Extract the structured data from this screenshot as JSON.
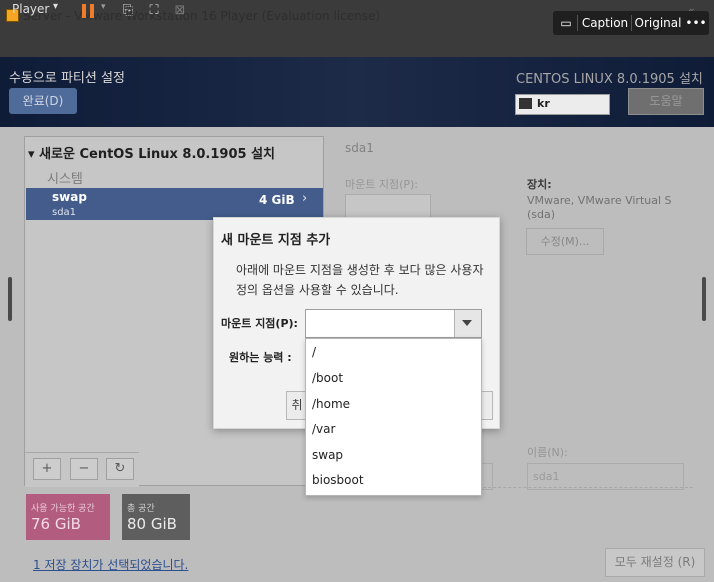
{
  "vmware": {
    "title": "Server - VMware Workstation 16 Player (Evaluation license)",
    "player_menu": "Player",
    "caption_bar": {
      "caption": "Caption",
      "original": "Original",
      "more": "•••"
    }
  },
  "installer": {
    "header_title": "수동으로 파티션 설정",
    "done_button": "완료(D)",
    "product_title": "CENTOS LINUX 8.0.1905 설치",
    "keyboard_layout": "kr",
    "help_button": "도움말"
  },
  "left_pane": {
    "install_title": "새로운 CentOS Linux 8.0.1905 설치",
    "section": "시스템",
    "selected_item": {
      "name": "swap",
      "device": "sda1",
      "size": "4 GiB"
    },
    "buttons": {
      "add": "+",
      "remove": "−",
      "refresh": "↻"
    },
    "available_space": {
      "label": "사용 가능한 공간",
      "value": "76 GiB"
    },
    "total_space": {
      "label": "총 공간",
      "value": "80 GiB"
    },
    "storage_link": "1 저장 장치가 선택되었습니다."
  },
  "right_pane": {
    "device_name": "sda1",
    "mount_point_label": "마운트 지점(P):",
    "device_label": "장치:",
    "device_value": "VMware, VMware Virtual S (sda)",
    "modify_button": "수정(M)...",
    "name_label": "이름(N):",
    "name_value": "sda1",
    "reset_button": "모두 재설정 (R)"
  },
  "dialog": {
    "title": "새 마운트 지점 추가",
    "description": "아래에 마운트 지점을 생성한 후 보다 많은 사용자 정의 옵션을 사용할 수 있습니다.",
    "mount_point_label": "마운트 지점(P):",
    "mount_point_value": "",
    "capacity_label": "원하는 능력 :",
    "cancel_button_partial": "취",
    "options": [
      "/",
      "/boot",
      "/home",
      "/var",
      "swap",
      "biosboot"
    ]
  }
}
